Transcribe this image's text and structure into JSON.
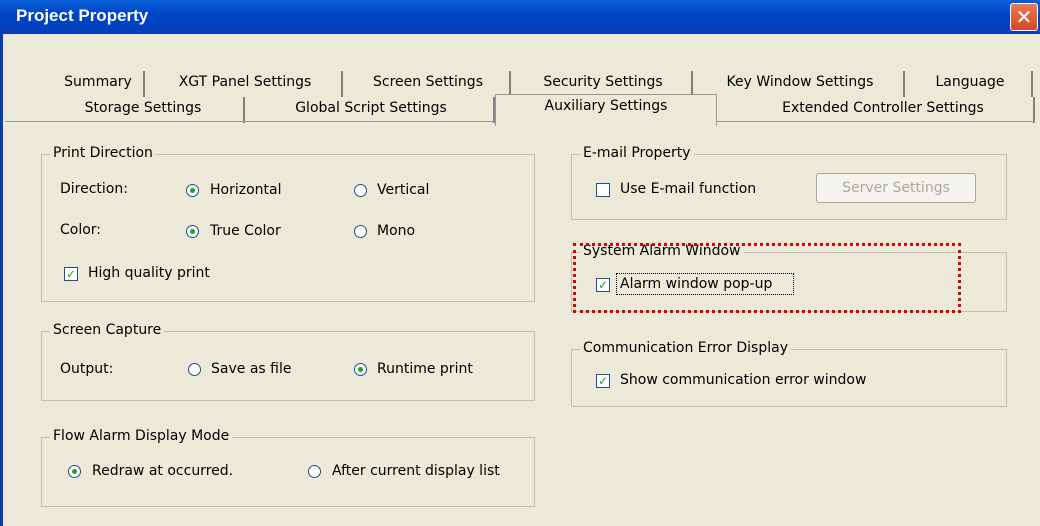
{
  "window": {
    "title": "Project Property",
    "close_glyph": "✕"
  },
  "tabs_row1": [
    "Summary",
    "XGT Panel Settings",
    "Screen Settings",
    "Security Settings",
    "Key Window Settings",
    "Language"
  ],
  "tabs_row2": [
    "Storage Settings",
    "Global Script Settings",
    "Auxiliary Settings",
    "Extended Controller Settings"
  ],
  "active_tab": "Auxiliary Settings",
  "print_direction": {
    "title": "Print Direction",
    "direction_label": "Direction:",
    "direction_options": [
      "Horizontal",
      "Vertical"
    ],
    "direction_selected": "Horizontal",
    "color_label": "Color:",
    "color_options": [
      "True Color",
      "Mono"
    ],
    "color_selected": "True Color",
    "high_quality_label": "High quality print",
    "high_quality_checked": true
  },
  "screen_capture": {
    "title": "Screen Capture",
    "output_label": "Output:",
    "options": [
      "Save as file",
      "Runtime print"
    ],
    "selected": "Runtime print"
  },
  "flow_alarm": {
    "title": "Flow Alarm Display Mode",
    "options": [
      "Redraw at occurred.",
      "After current display list"
    ],
    "selected": "Redraw at occurred."
  },
  "email": {
    "title": "E-mail Property",
    "use_label": "Use E-mail function",
    "use_checked": false,
    "server_button": "Server Settings"
  },
  "system_alarm": {
    "title": "System Alarm Window",
    "popup_label": "Alarm window pop-up",
    "popup_checked": true
  },
  "comm_error": {
    "title": "Communication Error Display",
    "show_label": "Show communication error window",
    "show_checked": true
  },
  "colors": {
    "title_bar": "#0046c8",
    "dialog_bg": "#ece9d8",
    "highlight": "#e00000",
    "check": "#21a121"
  }
}
